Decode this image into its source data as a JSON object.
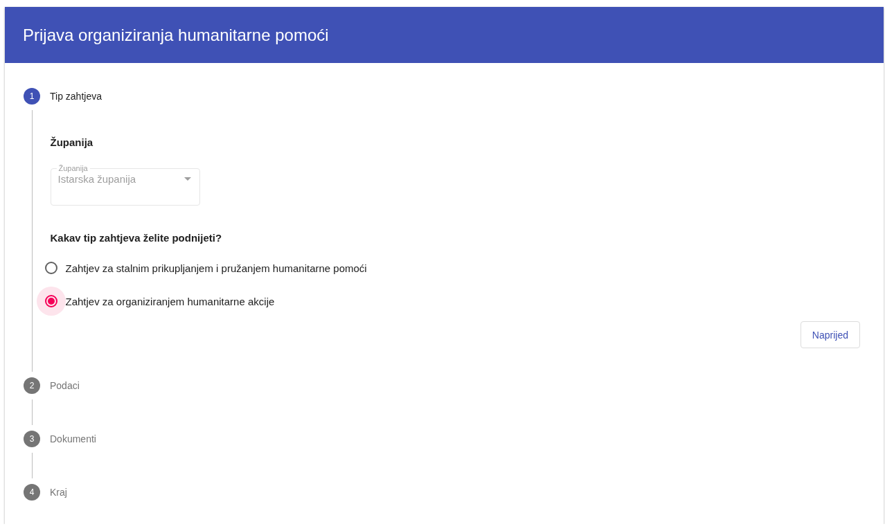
{
  "header": {
    "title": "Prijava organiziranja humanitarne pomoći"
  },
  "steps": [
    {
      "number": "1",
      "label": "Tip zahtjeva",
      "active": true,
      "content": {
        "section_title": "Županija",
        "select": {
          "label": "Županija",
          "value": "Istarska županija",
          "disabled": true
        },
        "question": "Kakav tip zahtjeva želite podnijeti?",
        "options": [
          {
            "label": "Zahtjev za stalnim prikupljanjem i pružanjem humanitarne pomoći",
            "selected": false
          },
          {
            "label": "Zahtjev za organiziranjem humanitarne akcije",
            "selected": true
          }
        ],
        "next_button": "Naprijed"
      }
    },
    {
      "number": "2",
      "label": "Podaci",
      "active": false
    },
    {
      "number": "3",
      "label": "Dokumenti",
      "active": false
    },
    {
      "number": "4",
      "label": "Kraj",
      "active": false
    }
  ]
}
